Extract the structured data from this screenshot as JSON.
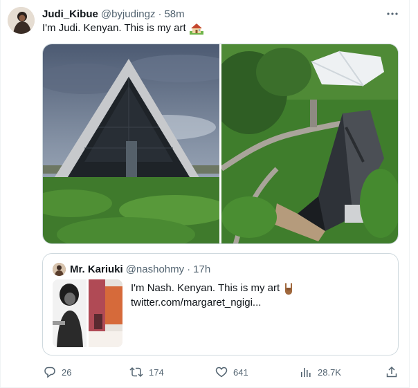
{
  "tweet": {
    "display_name": "Judi_Kibue",
    "handle": "@byjudingz",
    "separator": "·",
    "time": "58m",
    "text": "I'm Judi. Kenyan. This is my art",
    "emoji": "house-with-garden-emoji",
    "media": [
      {
        "description_icon": "a-frame-cabin-front-photo"
      },
      {
        "description_icon": "a-frame-cabin-aerial-photo"
      }
    ]
  },
  "quoted_tweet": {
    "display_name": "Mr. Kariuki",
    "handle": "@nashohmy",
    "separator": "·",
    "time": "17h",
    "text": "I'm Nash. Kenyan. This is my art",
    "emoji": "sign-of-the-horns-emoji",
    "link": "twitter.com/margaret_ngigi..."
  },
  "actions": {
    "replies": "26",
    "retweets": "174",
    "likes": "641",
    "views": "28.7K"
  },
  "colors": {
    "text_primary": "#0f1419",
    "text_secondary": "#536471",
    "border": "#cfd9de"
  },
  "icons": [
    "more-icon",
    "reply-icon",
    "retweet-icon",
    "like-icon",
    "views-icon",
    "share-icon"
  ]
}
